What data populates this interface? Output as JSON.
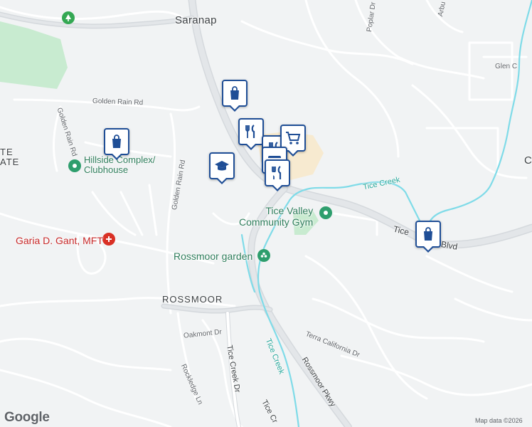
{
  "map": {
    "colors": {
      "background": "#f1f3f4",
      "road": "#ffffff",
      "road_casing": "#d5d9dd",
      "highway": "#dfe3e7",
      "water": "#7fdbe8",
      "park": "#c8ebd0",
      "commercial": "#f7ead0",
      "marker_border": "#1f4e96"
    }
  },
  "places": {
    "saranap": "Saranap",
    "rossmoor": "ROSSMOOR",
    "partial_left": "TE",
    "partial_left2": "ATE",
    "partial_right": "C"
  },
  "streets": {
    "golden_rain_rd_1": "Golden Rain Rd",
    "golden_rain_rd_2": "Golden Rain Rd",
    "golden_rain_rd_3": "Golden Rain Rd",
    "poplar_dr": "Poplar Dr",
    "arbutus": "Arbu",
    "glen": "Glen C",
    "tice_valley_blvd_a": "Tice",
    "tice_valley_blvd_b": "Blvd",
    "oakmont_dr": "Oakmont Dr",
    "rockledge_ln": "Rockledge Ln",
    "tice_creek_dr": "Tice Creek Dr",
    "tice_cr": "Tice Cr",
    "rossmoor_pkwy": "Rossmoor Pkwy",
    "terra_california_dr": "Terra California Dr"
  },
  "water": {
    "tice_creek_1": "Tice Creek",
    "tice_creek_2": "Tice Creek",
    "tice_creek_3": "Tice Creek"
  },
  "pois": {
    "hillside": "Hillside Complex/\nClubhouse",
    "gym": "Tice Valley\nCommunity Gym",
    "garden": "Rossmoor garden",
    "garia": "Garia D. Gant, MFT"
  },
  "markers": [
    {
      "type": "shopping-bag-icon",
      "name": "shopping-marker-top"
    },
    {
      "type": "shopping-bag-icon",
      "name": "shopping-marker-left"
    },
    {
      "type": "school-icon",
      "name": "school-marker"
    },
    {
      "type": "restaurant-icon",
      "name": "restaurant-marker-1"
    },
    {
      "type": "shopping-cart-icon",
      "name": "grocery-marker"
    },
    {
      "type": "restaurant-icon",
      "name": "restaurant-marker-2"
    },
    {
      "type": "restaurant-icon",
      "name": "restaurant-marker-3"
    },
    {
      "type": "shopping-bag-icon",
      "name": "shopping-marker-right"
    }
  ],
  "attribution": {
    "logo": "Google",
    "map_data": "Map data ©2026"
  }
}
